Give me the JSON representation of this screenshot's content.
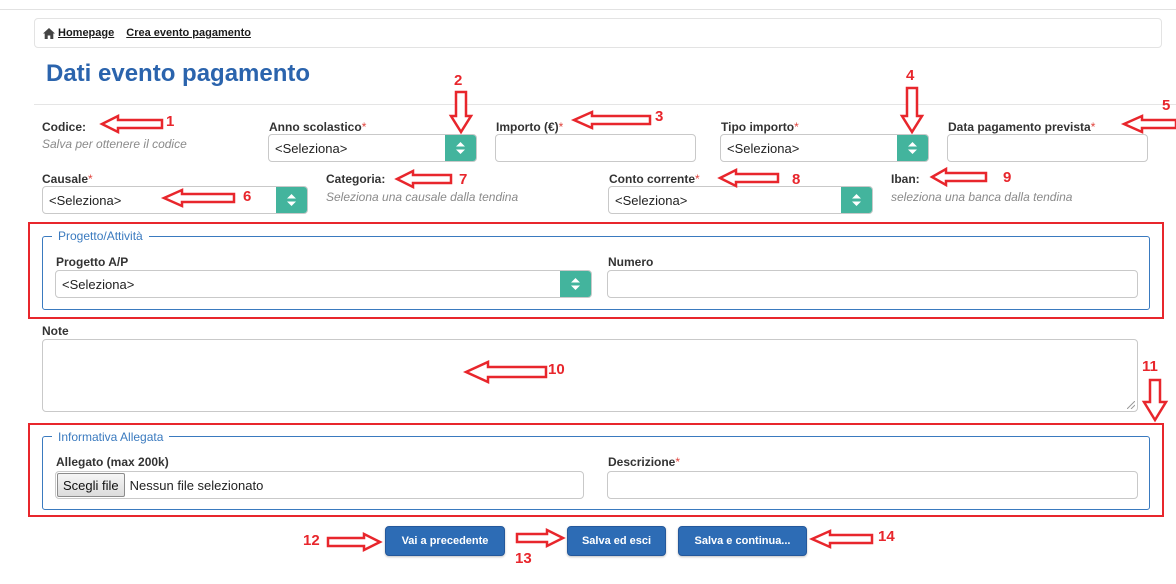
{
  "breadcrumb": {
    "home": "Homepage",
    "current": "Crea evento pagamento"
  },
  "page_title": "Dati evento pagamento",
  "fields": {
    "codice": {
      "label": "Codice:",
      "hint": "Salva per ottenere il codice"
    },
    "anno": {
      "label": "Anno scolastico",
      "value": "<Seleziona>"
    },
    "importo": {
      "label": "Importo (€)",
      "value": ""
    },
    "tipo_importo": {
      "label": "Tipo importo",
      "value": "<Seleziona>"
    },
    "data_pagamento": {
      "label": "Data pagamento prevista",
      "value": ""
    },
    "causale": {
      "label": "Causale",
      "value": "<Seleziona>"
    },
    "categoria": {
      "label": "Categoria:",
      "hint": "Seleziona una causale dalla tendina"
    },
    "conto": {
      "label": "Conto corrente",
      "value": "<Seleziona>"
    },
    "iban": {
      "label": "Iban:",
      "hint": "seleziona una banca dalla tendina"
    }
  },
  "progetto": {
    "legend": "Progetto/Attività",
    "progetto_label": "Progetto A/P",
    "progetto_value": "<Seleziona>",
    "numero_label": "Numero",
    "numero_value": ""
  },
  "note": {
    "label": "Note",
    "value": ""
  },
  "informativa": {
    "legend": "Informativa Allegata",
    "allegato_label": "Allegato (max 200k)",
    "file_button": "Scegli file",
    "file_status": "Nessun file selezionato",
    "descrizione_label": "Descrizione",
    "descrizione_value": ""
  },
  "buttons": {
    "prev": "Vai a precedente",
    "save_exit": "Salva ed esci",
    "save_continue": "Salva e continua..."
  },
  "annotations": [
    "1",
    "2",
    "3",
    "4",
    "5",
    "6",
    "7",
    "8",
    "9",
    "10",
    "11",
    "12",
    "13",
    "14"
  ],
  "colors": {
    "title": "#2b64ad",
    "select_arrow": "#43b49d",
    "button": "#2d6cb5",
    "annotation": "#e8262c",
    "required": "#e0443d"
  }
}
